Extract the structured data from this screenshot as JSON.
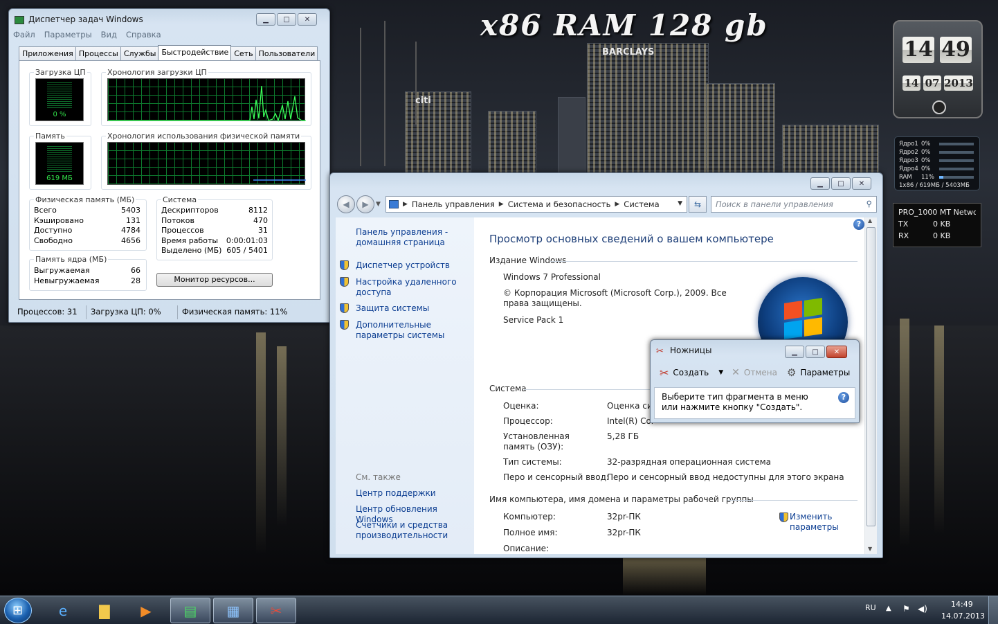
{
  "desktop": {
    "banner": "x86  RAM 128 gb",
    "wallpaper_signs": {
      "barclays": "BARCLAYS",
      "citi": "citi"
    }
  },
  "clock_gadget": {
    "hours": "14",
    "minutes": "49",
    "day": "14",
    "month": "07",
    "year": "2013"
  },
  "cpu_meter": {
    "rows": [
      {
        "name": "Ядро1",
        "value": "0%",
        "fill": 0
      },
      {
        "name": "Ядро2",
        "value": "0%",
        "fill": 0
      },
      {
        "name": "Ядро3",
        "value": "0%",
        "fill": 0
      },
      {
        "name": "Ядро4",
        "value": "0%",
        "fill": 0
      },
      {
        "name": "RAM",
        "value": "11%",
        "fill": 0.11
      }
    ],
    "footer": "1x86 / 619МБ / 5403МБ"
  },
  "net_meter": {
    "title": "PRO_1000 MT Netwc",
    "tx_label": "TX",
    "tx_value": "0 KB",
    "rx_label": "RX",
    "rx_value": "0 KB"
  },
  "task_manager": {
    "title": "Диспетчер задач Windows",
    "menu": [
      "Файл",
      "Параметры",
      "Вид",
      "Справка"
    ],
    "tabs": [
      "Приложения",
      "Процессы",
      "Службы",
      "Быстродействие",
      "Сеть",
      "Пользователи"
    ],
    "active_tab": "Быстродействие",
    "cpu_usage_title": "Загрузка ЦП",
    "cpu_usage_value": "0 %",
    "cpu_history_title": "Хронология загрузки ЦП",
    "memory_title": "Память",
    "memory_value": "619 МБ",
    "memory_history_title": "Хронология использования физической памяти",
    "physical_memory": {
      "title": "Физическая память (МБ)",
      "rows": [
        {
          "label": "Всего",
          "value": "5403"
        },
        {
          "label": "Кэшировано",
          "value": "131"
        },
        {
          "label": "Доступно",
          "value": "4784"
        },
        {
          "label": "Свободно",
          "value": "4656"
        }
      ]
    },
    "kernel_memory": {
      "title": "Память ядра (МБ)",
      "rows": [
        {
          "label": "Выгружаемая",
          "value": "66"
        },
        {
          "label": "Невыгружаемая",
          "value": "28"
        }
      ]
    },
    "system": {
      "title": "Система",
      "rows": [
        {
          "label": "Дескрипторов",
          "value": "8112"
        },
        {
          "label": "Потоков",
          "value": "470"
        },
        {
          "label": "Процессов",
          "value": "31"
        },
        {
          "label": "Время работы",
          "value": "0:00:01:03"
        },
        {
          "label": "Выделено (МБ)",
          "value": "605 / 5401"
        }
      ]
    },
    "resource_monitor_button": "Монитор ресурсов...",
    "status": {
      "processes": "Процессов: 31",
      "cpu": "Загрузка ЦП: 0%",
      "memory": "Физическая память: 11%"
    }
  },
  "control_panel": {
    "breadcrumb": [
      "Панель управления",
      "Система и безопасность",
      "Система"
    ],
    "search_placeholder": "Поиск в панели управления",
    "left": {
      "home_link": "Панель управления - домашняя страница",
      "links": [
        "Диспетчер устройств",
        "Настройка удаленного доступа",
        "Защита системы",
        "Дополнительные параметры системы"
      ],
      "see_also_title": "См. также",
      "see_also": [
        "Центр поддержки",
        "Центр обновления Windows",
        "Счетчики и средства производительности"
      ]
    },
    "heading": "Просмотр основных сведений о вашем компьютере",
    "edition_section": "Издание Windows",
    "edition_name": "Windows 7 Professional",
    "copyright": "© Корпорация Microsoft (Microsoft Corp.), 2009. Все права защищены.",
    "service_pack": "Service Pack 1",
    "system_section": "Система",
    "system_rows": [
      {
        "label": "Оценка:",
        "value": "Оценка сис"
      },
      {
        "label": "Процессор:",
        "value": "Intel(R) Cor"
      },
      {
        "label": "Установленная память (ОЗУ):",
        "value": "5,28 ГБ"
      },
      {
        "label": "Тип системы:",
        "value": "32-разрядная операционная система"
      },
      {
        "label": "Перо и сенсорный ввод:",
        "value": "Перо и сенсорный ввод недоступны для этого экрана"
      }
    ],
    "computer_section": "Имя компьютера, имя домена и параметры рабочей группы",
    "computer_rows": [
      {
        "label": "Компьютер:",
        "value": "32pr-ПК"
      },
      {
        "label": "Полное имя:",
        "value": "32pr-ПК"
      },
      {
        "label": "Описание:",
        "value": ""
      }
    ],
    "change_settings_link": "Изменить параметры"
  },
  "snipping_tool": {
    "title": "Ножницы",
    "new_button": "Создать",
    "cancel_button": "Отмена",
    "options_button": "Параметры",
    "message": "Выберите тип фрагмента в меню или нажмите кнопку \"Создать\"."
  },
  "taskbar": {
    "apps": [
      "internet-explorer",
      "windows-explorer",
      "media-player",
      "task-manager",
      "control-panel",
      "snipping-tool"
    ],
    "language": "RU",
    "time": "14:49",
    "date": "14.07.2013"
  },
  "colors": {
    "link": "#0b3d91",
    "heading": "#1e3f78",
    "meter_green": "#32e24a"
  }
}
